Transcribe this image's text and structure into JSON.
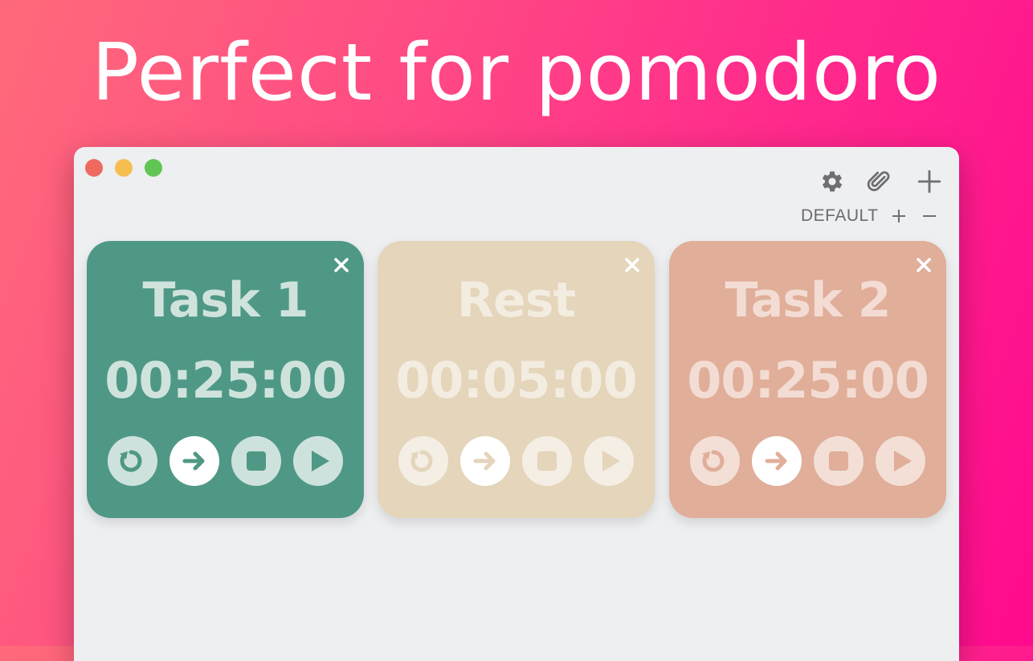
{
  "headline": "Perfect for pomodoro",
  "window": {
    "toolbar": {
      "settings_icon": "gear-icon",
      "attach_icon": "paperclip-icon",
      "add_icon": "plus-icon"
    },
    "profile": {
      "name": "DEFAULT",
      "add_icon": "plus-icon",
      "remove_icon": "minus-icon"
    }
  },
  "timers": [
    {
      "title": "Task 1",
      "time": "00:25:00",
      "bg_color": "#4f9886",
      "text_color": "#cfe3dc",
      "accent_color": "#4f9886",
      "state": "active"
    },
    {
      "title": "Rest",
      "time": "00:05:00",
      "bg_color": "#e4d5bb",
      "text_color": "#f3ece0",
      "accent_color": "#e4d5bb",
      "state": "inactive"
    },
    {
      "title": "Task 2",
      "time": "00:25:00",
      "bg_color": "#e0ae99",
      "text_color": "#f3dcd3",
      "accent_color": "#e0ae99",
      "state": "inactive"
    }
  ],
  "controls": [
    "reset-icon",
    "next-arrow-icon",
    "stop-icon",
    "play-icon"
  ],
  "colors": {
    "background_start": "#ff6a7a",
    "background_end": "#ff0a8e",
    "window_bg": "#eeeff1"
  }
}
